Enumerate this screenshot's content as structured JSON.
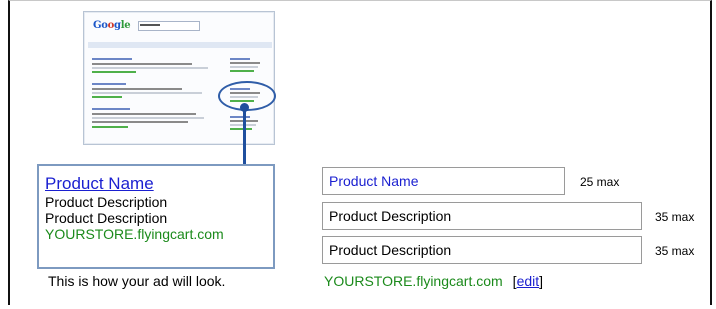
{
  "thumbnail": {
    "logo": {
      "part1": "Go",
      "part2": "o",
      "part3": "g",
      "part4": "le"
    }
  },
  "preview": {
    "title": "Product Name",
    "desc1": "Product Description",
    "desc2": "Product Description",
    "url": "YOURSTORE.flyingcart.com",
    "caption": "This is how your ad will look."
  },
  "form": {
    "name_value": "Product Name",
    "name_max": "25 max",
    "desc1_value": "Product Description",
    "desc1_max": "35 max",
    "desc2_value": "Product Description",
    "desc2_max": "35 max",
    "url": "YOURSTORE.flyingcart.com",
    "edit_open": "[",
    "edit_label": "edit",
    "edit_close": "]"
  },
  "colors": {
    "link": "#1a1fd0",
    "url_green": "#1b8a1b",
    "highlight_blue": "#1f4f9e"
  }
}
